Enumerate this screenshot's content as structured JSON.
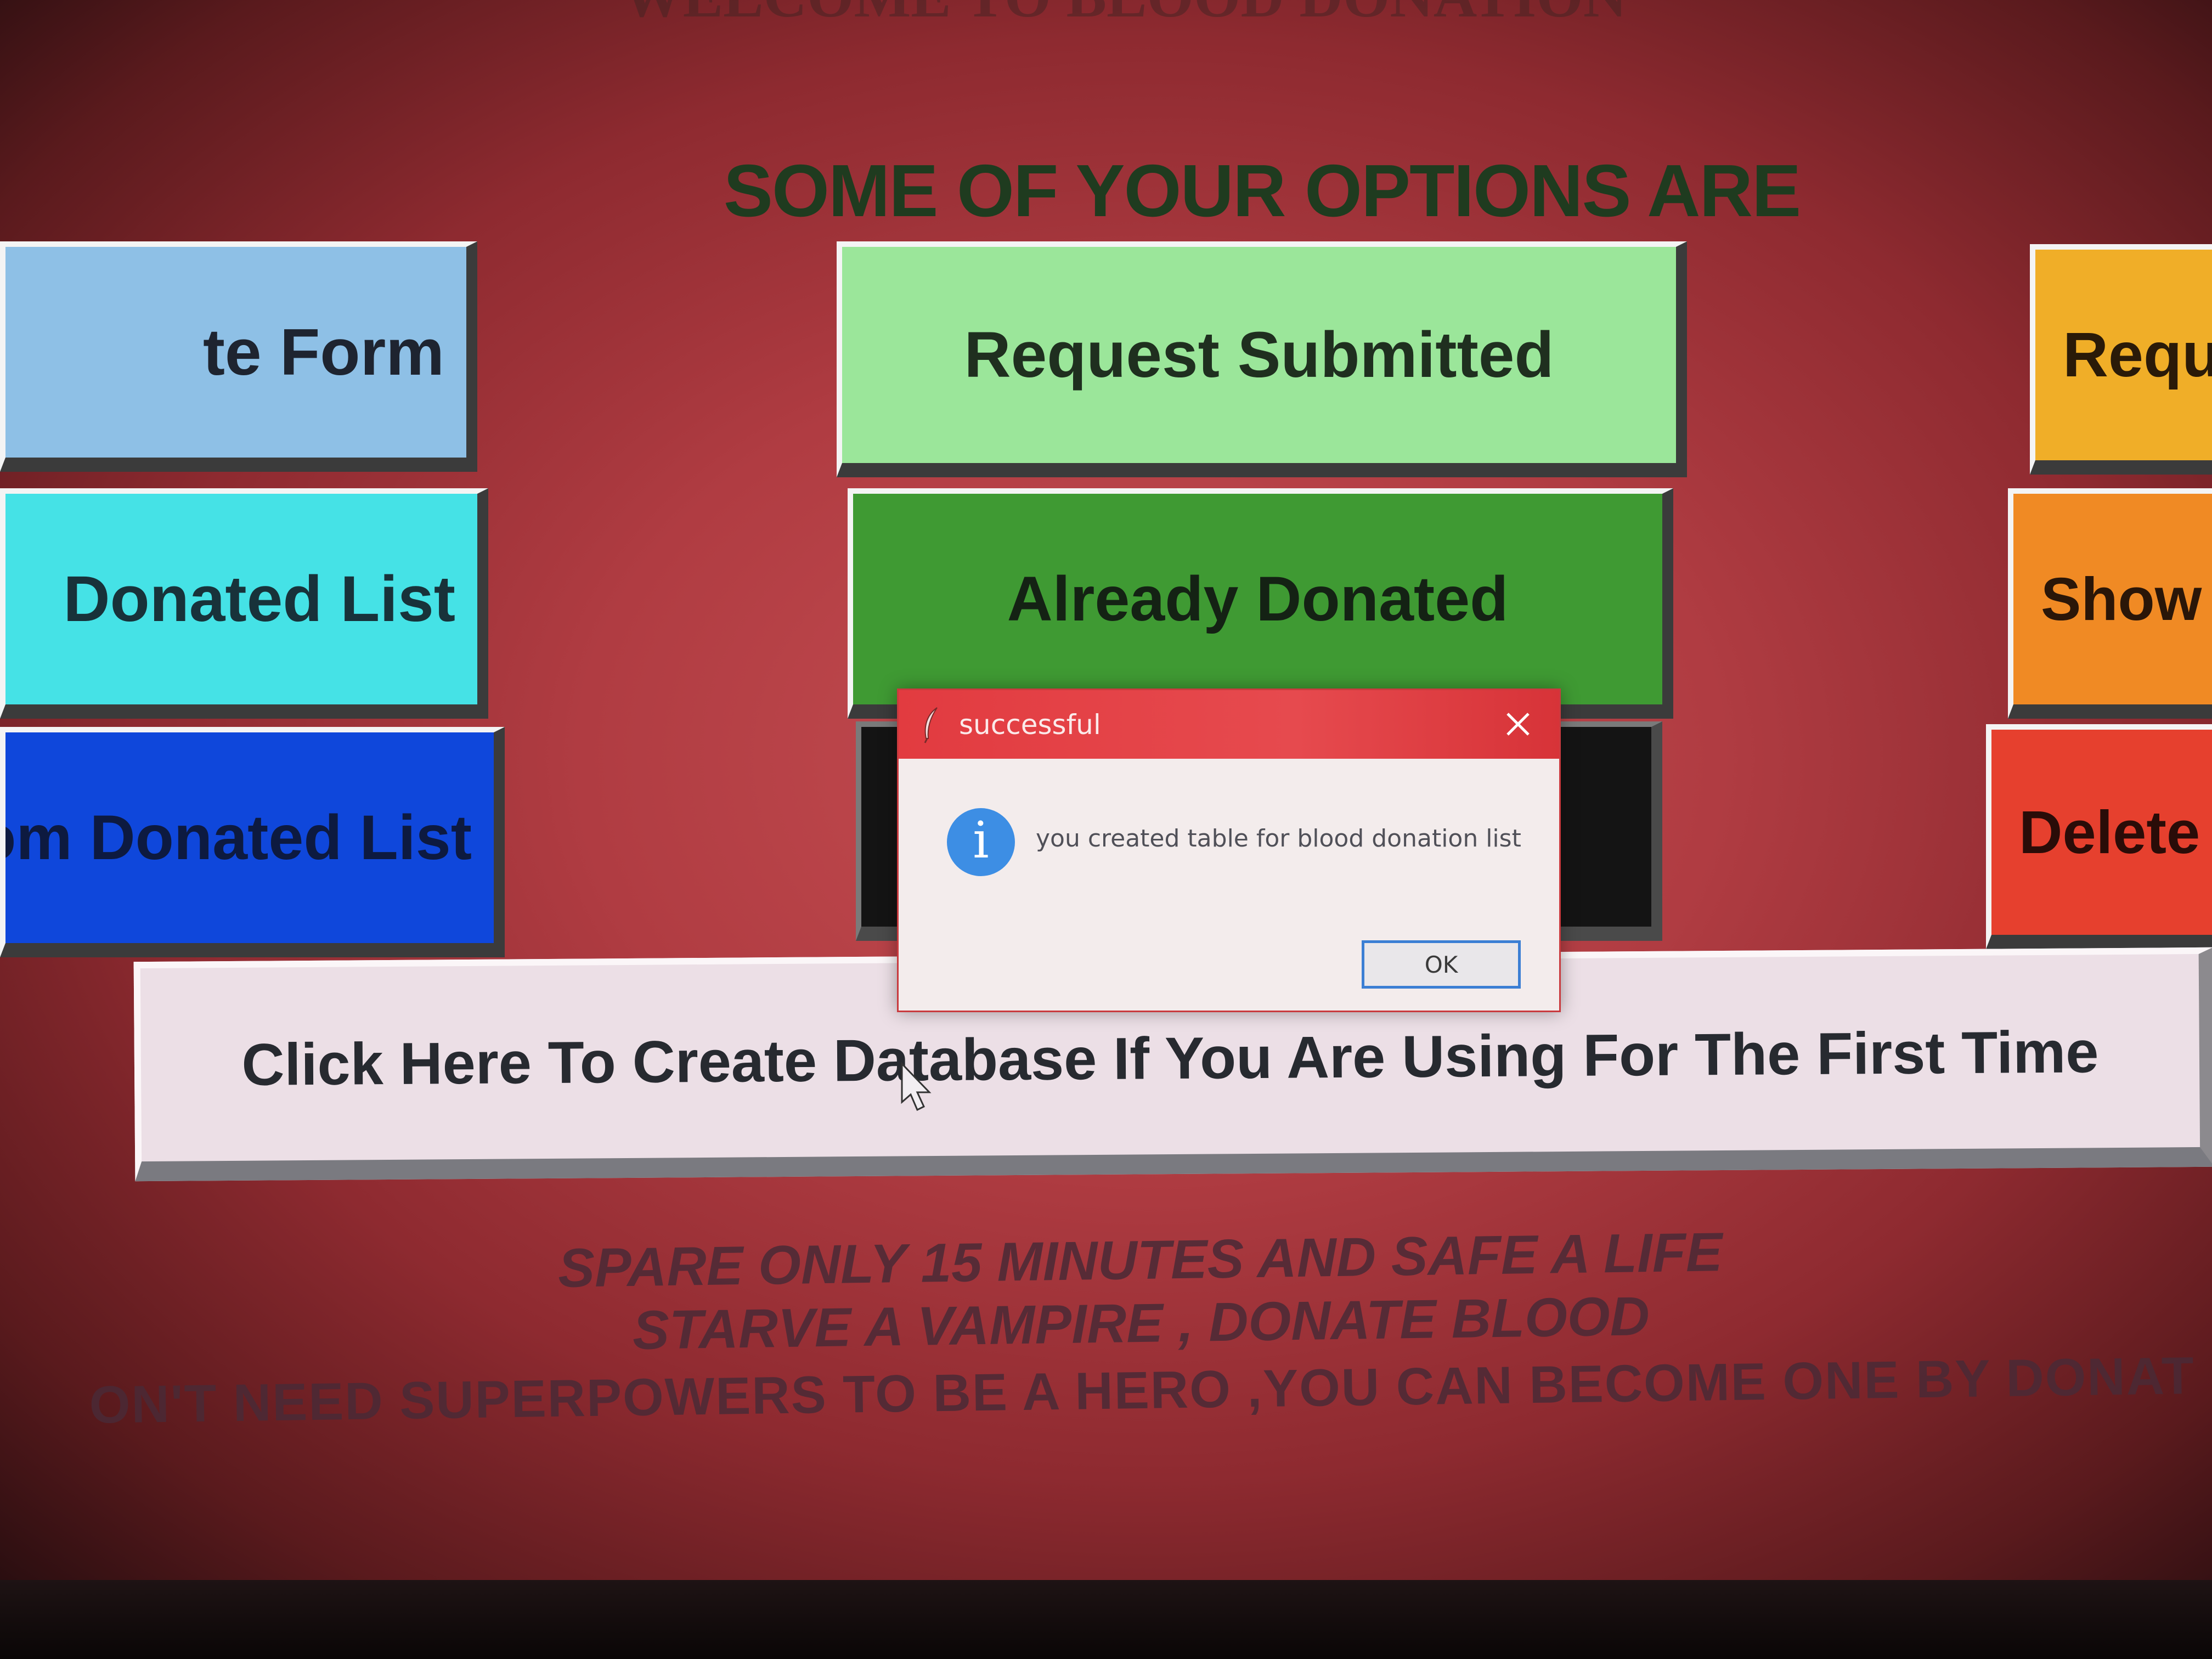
{
  "window": {
    "partial_title": "WELCOME TO BLOOD DONATION"
  },
  "heading": "SOME OF YOUR OPTIONS ARE",
  "left_column": [
    {
      "label": "te Form"
    },
    {
      "label": "Donated List"
    },
    {
      "label": "om Donated List"
    }
  ],
  "center_column": [
    {
      "label": "Request Submitted"
    },
    {
      "label": "Already Donated"
    },
    {
      "label": ""
    }
  ],
  "right_column": [
    {
      "label": "Requi"
    },
    {
      "label": "Show"
    },
    {
      "label": "Delete"
    }
  ],
  "create_db_button": {
    "label": "Click Here To Create Database If You Are Using For The First Time"
  },
  "slogans": [
    "SPARE ONLY 15 MINUTES AND SAFE A LIFE",
    "STARVE A VAMPIRE , DONATE BLOOD",
    "ON'T NEED SUPERPOWERS TO BE A HERO ,YOU CAN BECOME ONE BY DONAT"
  ],
  "dialog": {
    "title": "successful",
    "message": "you created table for blood donation list",
    "ok_label": "OK",
    "icons": {
      "title": "feather-icon",
      "info": "info-icon",
      "close": "close-icon"
    },
    "colors": {
      "titlebar": "#e23b40",
      "info": "#3d8ee4",
      "ok_border": "#3b7fd4"
    }
  }
}
